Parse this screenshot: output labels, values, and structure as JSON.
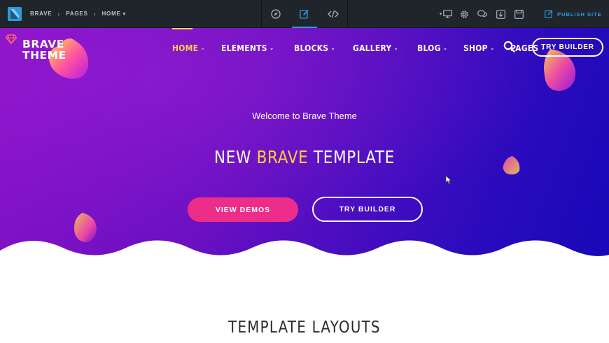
{
  "editor": {
    "breadcrumbs": [
      "BRAVE",
      "PAGES",
      "HOME"
    ],
    "modes": [
      {
        "icon": "compass-icon",
        "active": false
      },
      {
        "icon": "edit-icon",
        "active": true
      },
      {
        "icon": "code-icon",
        "active": false
      }
    ],
    "tools": [
      "desktop-icon",
      "gear-icon",
      "comments-icon",
      "download-icon",
      "save-icon"
    ],
    "publish_label": "PUBLISH SITE",
    "accent": "#2d9cdb"
  },
  "site": {
    "logo_line1": "BRAVE",
    "logo_line2": "THEME",
    "nav": [
      {
        "label": "HOME",
        "active": true
      },
      {
        "label": "ELEMENTS",
        "active": false
      },
      {
        "label": "BLOCKS",
        "active": false
      },
      {
        "label": "GALLERY",
        "active": false
      },
      {
        "label": "BLOG",
        "active": false
      },
      {
        "label": "SHOP",
        "active": false
      },
      {
        "label": "PAGES",
        "active": false
      }
    ],
    "nav_caret": "⌄",
    "try_builder_top": "TRY BUILDER",
    "colors": {
      "accent_yellow": "#ffcd3c",
      "pink": "#ec2e8a",
      "purple": "#6a10c2"
    }
  },
  "hero": {
    "welcome": "Welcome to Brave Theme",
    "headline_pre": "NEW ",
    "headline_accent": "BRAVE",
    "headline_post": " TEMPLATE",
    "btn_demos": "VIEW DEMOS",
    "btn_try": "TRY BUILDER"
  },
  "section": {
    "title": "TEMPLATE LAYOUTS"
  }
}
